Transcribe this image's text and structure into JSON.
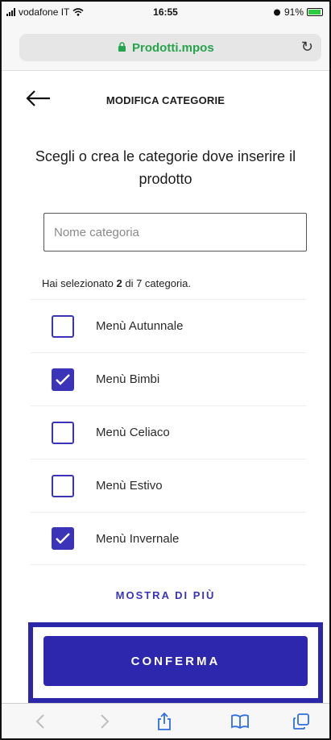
{
  "status_bar": {
    "carrier": "vodafone IT",
    "time": "16:55",
    "battery": "91%"
  },
  "browser": {
    "url": "Prodotti.mpos",
    "reload_icon": "reload-icon",
    "lock_icon": "lock-icon"
  },
  "header": {
    "back_icon": "arrow-left-icon",
    "title": "MODIFICA CATEGORIE"
  },
  "main": {
    "heading": "Scegli o crea le categorie dove inserire il prodotto",
    "input": {
      "value": "",
      "placeholder": "Nome categoria"
    },
    "selection": {
      "prefix": "Hai selezionato ",
      "count": "2",
      "suffix": " di 7 categoria."
    },
    "categories": [
      {
        "label": "Menù Autunnale",
        "checked": false
      },
      {
        "label": "Menù Bimbi",
        "checked": true
      },
      {
        "label": "Menù Celiaco",
        "checked": false
      },
      {
        "label": "Menù Estivo",
        "checked": false
      },
      {
        "label": "Menù Invernale",
        "checked": true
      }
    ],
    "show_more": "MOSTRA DI PIÙ",
    "confirm": "CONFERMA"
  },
  "toolbar": {
    "icons": [
      "back-icon",
      "forward-icon",
      "share-icon",
      "bookmarks-icon",
      "tabs-icon"
    ]
  },
  "colors": {
    "accent": "#2d27ad",
    "secure_url": "#26a44b"
  }
}
